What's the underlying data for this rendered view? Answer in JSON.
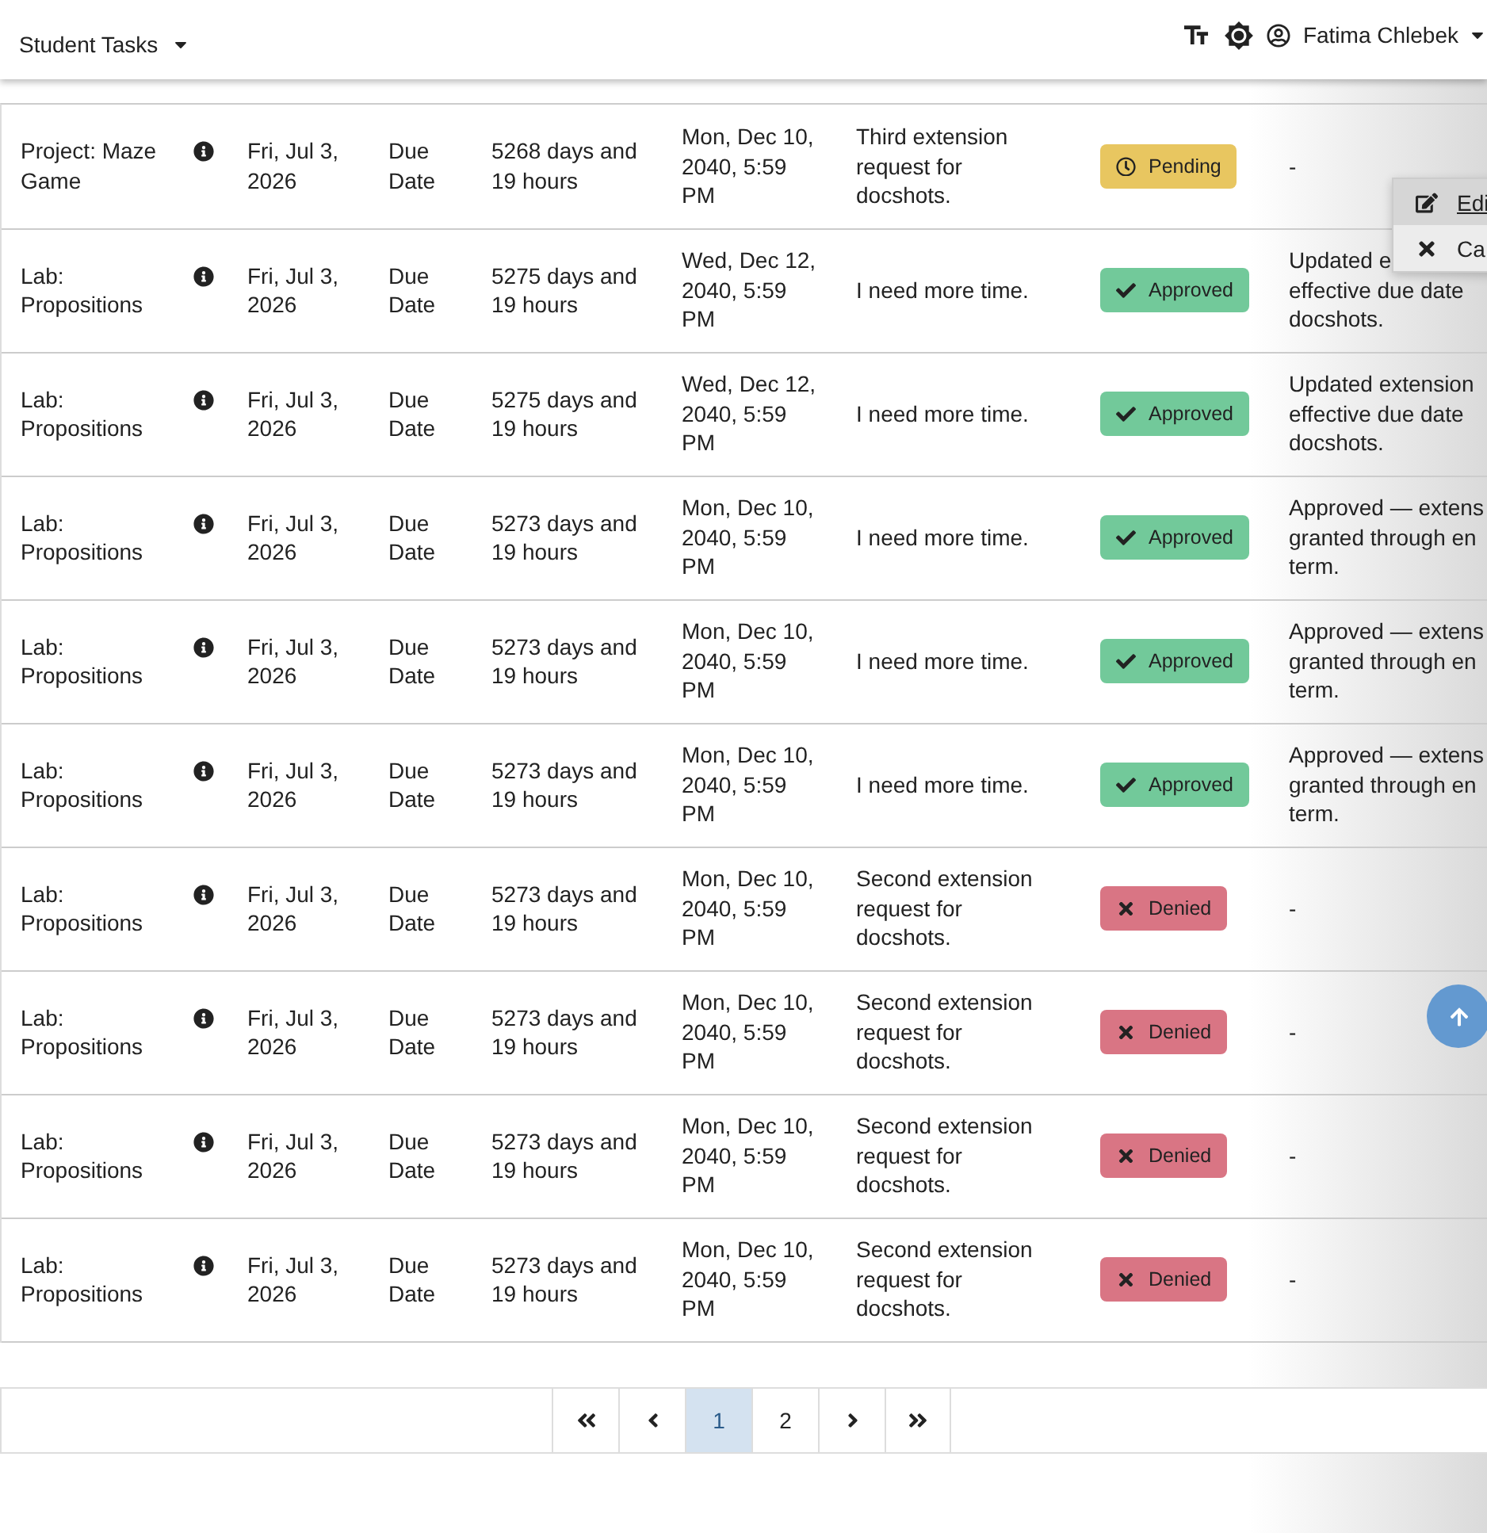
{
  "header": {
    "title": "Student Tasks",
    "user": "Fatima Chlebek"
  },
  "rows": [
    {
      "task": "Project: Maze Game",
      "date": "Fri, Jul 3, 2026",
      "due_type": "Due Date",
      "remaining": "5268 days and 19 hours",
      "new_due": "Mon, Dec 10, 2040, 5:59 PM",
      "reason": "Third extension request for docshots.",
      "status": {
        "kind": "pending",
        "label": "Pending"
      },
      "notes": "-"
    },
    {
      "task": "Lab: Propositions",
      "date": "Fri, Jul 3, 2026",
      "due_type": "Due Date",
      "remaining": "5275 days and 19 hours",
      "new_due": "Wed, Dec 12, 2040, 5:59 PM",
      "reason": "I need more time.",
      "status": {
        "kind": "approved",
        "label": "Approved"
      },
      "notes": "Updated e\neffective due date\ndocshots."
    },
    {
      "task": "Lab: Propositions",
      "date": "Fri, Jul 3, 2026",
      "due_type": "Due Date",
      "remaining": "5275 days and 19 hours",
      "new_due": "Wed, Dec 12, 2040, 5:59 PM",
      "reason": "I need more time.",
      "status": {
        "kind": "approved",
        "label": "Approved"
      },
      "notes": "Updated extension\neffective due date\ndocshots."
    },
    {
      "task": "Lab: Propositions",
      "date": "Fri, Jul 3, 2026",
      "due_type": "Due Date",
      "remaining": "5273 days and 19 hours",
      "new_due": "Mon, Dec 10, 2040, 5:59 PM",
      "reason": "I need more time.",
      "status": {
        "kind": "approved",
        "label": "Approved"
      },
      "notes": "Approved — extens\ngranted through en\nterm."
    },
    {
      "task": "Lab: Propositions",
      "date": "Fri, Jul 3, 2026",
      "due_type": "Due Date",
      "remaining": "5273 days and 19 hours",
      "new_due": "Mon, Dec 10, 2040, 5:59 PM",
      "reason": "I need more time.",
      "status": {
        "kind": "approved",
        "label": "Approved"
      },
      "notes": "Approved — extens\ngranted through en\nterm."
    },
    {
      "task": "Lab: Propositions",
      "date": "Fri, Jul 3, 2026",
      "due_type": "Due Date",
      "remaining": "5273 days and 19 hours",
      "new_due": "Mon, Dec 10, 2040, 5:59 PM",
      "reason": "I need more time.",
      "status": {
        "kind": "approved",
        "label": "Approved"
      },
      "notes": "Approved — extens\ngranted through en\nterm."
    },
    {
      "task": "Lab: Propositions",
      "date": "Fri, Jul 3, 2026",
      "due_type": "Due Date",
      "remaining": "5273 days and 19 hours",
      "new_due": "Mon, Dec 10, 2040, 5:59 PM",
      "reason": "Second extension request for docshots.",
      "status": {
        "kind": "denied",
        "label": "Denied"
      },
      "notes": "-"
    },
    {
      "task": "Lab: Propositions",
      "date": "Fri, Jul 3, 2026",
      "due_type": "Due Date",
      "remaining": "5273 days and 19 hours",
      "new_due": "Mon, Dec 10, 2040, 5:59 PM",
      "reason": "Second extension request for docshots.",
      "status": {
        "kind": "denied",
        "label": "Denied"
      },
      "notes": "-"
    },
    {
      "task": "Lab: Propositions",
      "date": "Fri, Jul 3, 2026",
      "due_type": "Due Date",
      "remaining": "5273 days and 19 hours",
      "new_due": "Mon, Dec 10, 2040, 5:59 PM",
      "reason": "Second extension request for docshots.",
      "status": {
        "kind": "denied",
        "label": "Denied"
      },
      "notes": "-"
    },
    {
      "task": "Lab: Propositions",
      "date": "Fri, Jul 3, 2026",
      "due_type": "Due Date",
      "remaining": "5273 days and 19 hours",
      "new_due": "Mon, Dec 10, 2040, 5:59 PM",
      "reason": "Second extension request for docshots.",
      "status": {
        "kind": "denied",
        "label": "Denied"
      },
      "notes": "-"
    }
  ],
  "menu": [
    {
      "kind": "edit",
      "label": "Edi",
      "selected": true
    },
    {
      "kind": "cancel",
      "label": "Ca",
      "selected": false
    }
  ],
  "pagination": [
    {
      "kind": "first",
      "selected": false
    },
    {
      "kind": "prev",
      "selected": false
    },
    {
      "kind": "page",
      "label": "1",
      "selected": true
    },
    {
      "kind": "page",
      "label": "2",
      "selected": false
    },
    {
      "kind": "next",
      "selected": false
    },
    {
      "kind": "last",
      "selected": false
    }
  ]
}
